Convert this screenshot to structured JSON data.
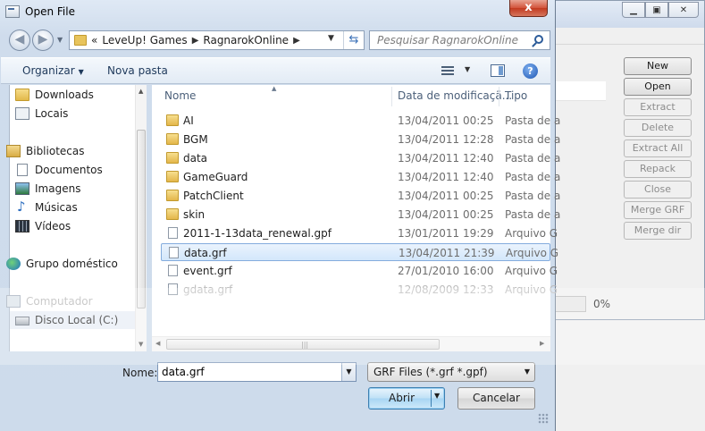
{
  "background_app": {
    "buttons": [
      {
        "label": "New",
        "enabled": true
      },
      {
        "label": "Open",
        "enabled": true
      },
      {
        "label": "Extract",
        "enabled": false
      },
      {
        "label": "Delete",
        "enabled": false
      },
      {
        "label": "Extract All",
        "enabled": false
      },
      {
        "label": "Repack",
        "enabled": false
      },
      {
        "label": "Close",
        "enabled": false
      },
      {
        "label": "Merge GRF",
        "enabled": false
      },
      {
        "label": "Merge dir",
        "enabled": false
      }
    ],
    "progress_label": "0%",
    "progress": 0
  },
  "dialog": {
    "title": "Open File",
    "close_glyph": "x",
    "breadcrumb": {
      "overflow": "«",
      "items": [
        "LeveUp! Games",
        "RagnarokOnline"
      ]
    },
    "search_placeholder": "Pesquisar RagnarokOnline",
    "toolbar": {
      "organize_label": "Organizar",
      "new_folder_label": "Nova pasta",
      "help_glyph": "?"
    },
    "nav": [
      {
        "label": "Downloads",
        "icon": "downloads-folder-icon"
      },
      {
        "label": "Locais",
        "icon": "recent-places-icon"
      },
      {
        "label": "Bibliotecas",
        "icon": "libraries-icon"
      },
      {
        "label": "Documentos",
        "icon": "documents-icon"
      },
      {
        "label": "Imagens",
        "icon": "pictures-icon"
      },
      {
        "label": "Músicas",
        "icon": "music-icon"
      },
      {
        "label": "Vídeos",
        "icon": "videos-icon"
      },
      {
        "label": "Grupo doméstico",
        "icon": "homegroup-icon"
      },
      {
        "label": "Computador",
        "icon": "computer-icon"
      },
      {
        "label": "Disco Local (C:)",
        "icon": "local-disk-icon"
      }
    ],
    "columns": {
      "name": "Nome",
      "date": "Data de modificaçã...",
      "type": "Tipo"
    },
    "files": [
      {
        "name": "AI",
        "date": "13/04/2011 00:25",
        "type": "Pasta de a",
        "kind": "folder"
      },
      {
        "name": "BGM",
        "date": "13/04/2011 12:28",
        "type": "Pasta de a",
        "kind": "folder"
      },
      {
        "name": "data",
        "date": "13/04/2011 12:40",
        "type": "Pasta de a",
        "kind": "folder"
      },
      {
        "name": "GameGuard",
        "date": "13/04/2011 12:40",
        "type": "Pasta de a",
        "kind": "folder"
      },
      {
        "name": "PatchClient",
        "date": "13/04/2011 00:25",
        "type": "Pasta de a",
        "kind": "folder"
      },
      {
        "name": "skin",
        "date": "13/04/2011 00:25",
        "type": "Pasta de a",
        "kind": "folder"
      },
      {
        "name": "2011-1-13data_renewal.gpf",
        "date": "13/01/2011 19:29",
        "type": "Arquivo G",
        "kind": "file"
      },
      {
        "name": "data.grf",
        "date": "13/04/2011 21:39",
        "type": "Arquivo G",
        "kind": "file",
        "selected": true
      },
      {
        "name": "event.grf",
        "date": "27/01/2010 16:00",
        "type": "Arquivo G",
        "kind": "file"
      },
      {
        "name": "gdata.grf",
        "date": "12/08/2009 12:33",
        "type": "Arquivo G",
        "kind": "file",
        "faded": true
      }
    ],
    "filename_label": "Nome:",
    "filename_value": "data.grf",
    "filter_value": "GRF Files (*.grf *.gpf)",
    "open_label": "Abrir",
    "cancel_label": "Cancelar"
  }
}
